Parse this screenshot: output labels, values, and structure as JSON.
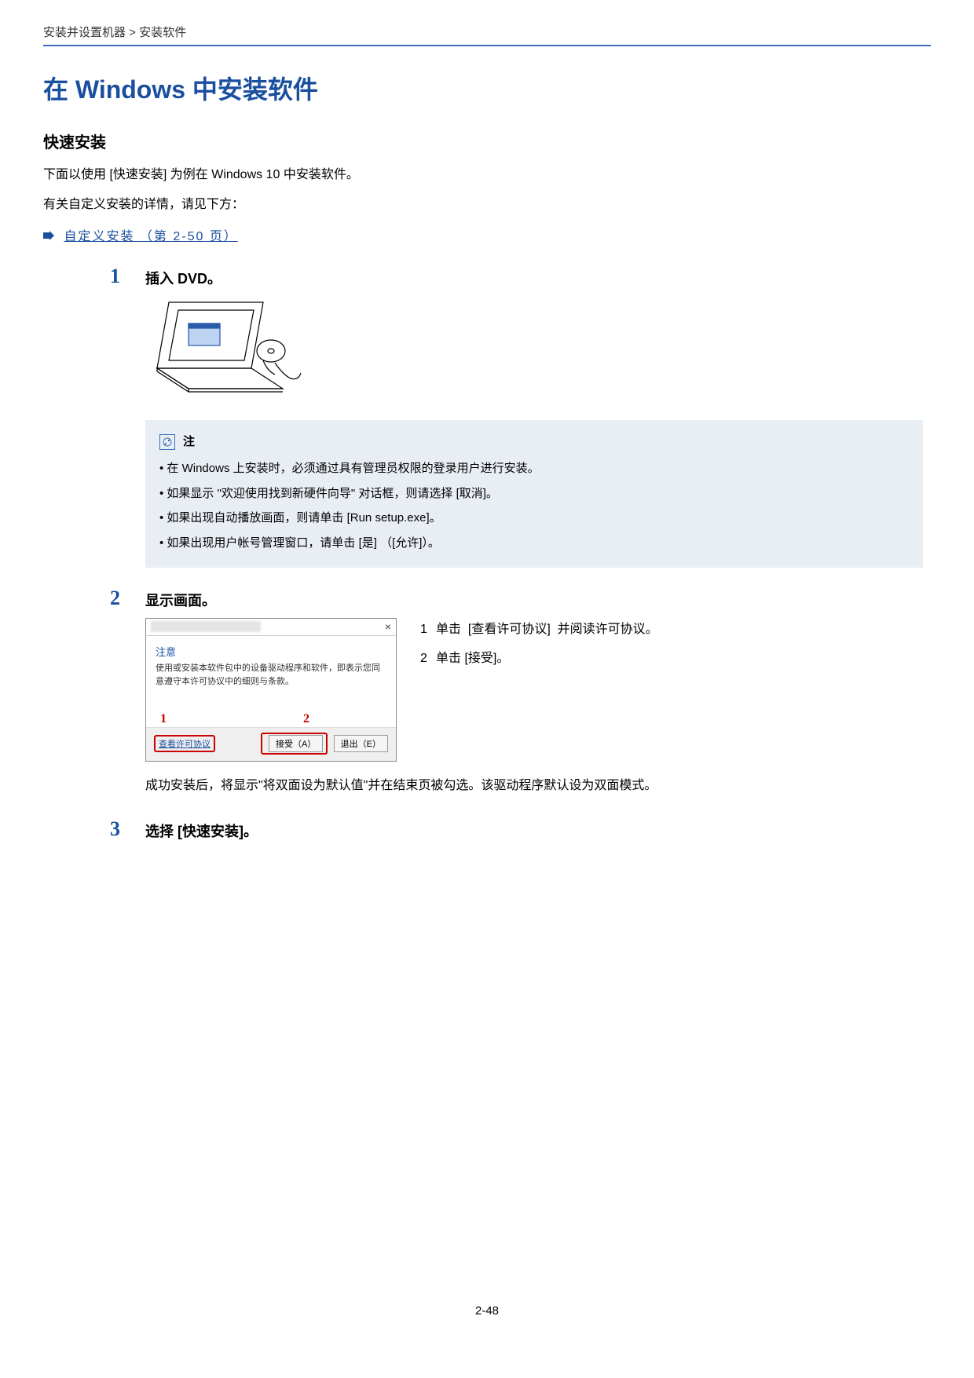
{
  "breadcrumb": "安装并设置机器 > 安装软件",
  "title": "在 Windows 中安装软件",
  "section": "快速安装",
  "intro1": "下面以使用 [快速安装] 为例在 Windows 10 中安装软件。",
  "intro2": "有关自定义安装的详情，请见下方：",
  "xref": "自定义安装 （第 2-50 页）",
  "steps": {
    "s1": {
      "num": "1",
      "title": "插入 DVD。"
    },
    "s2": {
      "num": "2",
      "title": "显示画面。"
    },
    "s3": {
      "num": "3",
      "title": "选择 [快速安装]。"
    }
  },
  "note": {
    "label": "注",
    "items": [
      "在 Windows 上安装时，必须通过具有管理员权限的登录用户进行安装。",
      "如果显示 \"欢迎使用找到新硬件向导\" 对话框，则请选择 [取消]。",
      "如果出现自动播放画面，则请单击 [Run setup.exe]。",
      "如果出现用户帐号管理窗口，请单击 [是] （[允许]）。"
    ]
  },
  "dialog": {
    "close": "×",
    "noticeTitle": "注意",
    "noticeText": "使用或安装本软件包中的设备驱动程序和软件，即表示您同意遵守本许可协议中的细则与条款。",
    "linkView": "查看许可协议",
    "btnAccept": "接受（A）",
    "btnExit": "退出（E）",
    "callout1": "1",
    "callout2": "2"
  },
  "rightList": {
    "r1n": "1",
    "r1t": "单击  [查看许可协议]  并阅读许可协议。",
    "r2n": "2",
    "r2t": "单击 [接受]。"
  },
  "postNote": "成功安装后，将显示\"将双面设为默认值\"并在结束页被勾选。该驱动程序默认设为双面模式。",
  "pageNum": "2-48"
}
